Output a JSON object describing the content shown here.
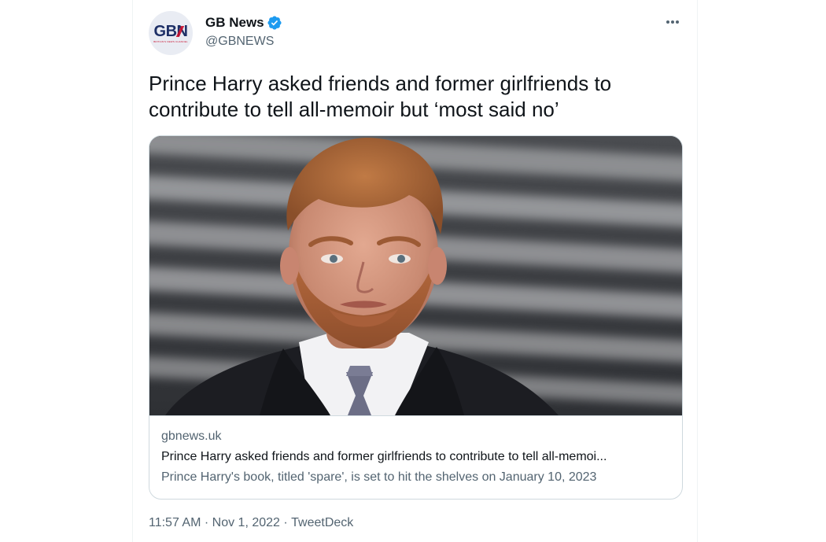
{
  "account": {
    "display_name": "GB News",
    "handle": "@GBNEWS",
    "verified": true,
    "avatar_logo": {
      "letters": [
        "G",
        "B",
        "N"
      ],
      "tagline": "BRITAIN'S NEWS CHANNEL"
    }
  },
  "tweet": {
    "text": "Prince Harry asked friends and former girlfriends to contribute to tell all-memoir but ‘most said no’"
  },
  "card": {
    "domain": "gbnews.uk",
    "title": "Prince Harry asked friends and former girlfriends to contribute to tell all-memoi...",
    "description": "Prince Harry's book, titled 'spare', is set to hit the shelves on January 10, 2023"
  },
  "meta": {
    "time": "11:57 AM",
    "separator": " · ",
    "date": "Nov 1, 2022",
    "source": "TweetDeck"
  },
  "icons": {
    "verified": "verified-badge-icon",
    "more": "more-options-icon"
  },
  "colors": {
    "verified_blue": "#1d9bf0",
    "secondary_text": "#536471",
    "border": "#cfd9de",
    "logo_navy": "#1d2f66",
    "logo_red": "#c8102e"
  }
}
